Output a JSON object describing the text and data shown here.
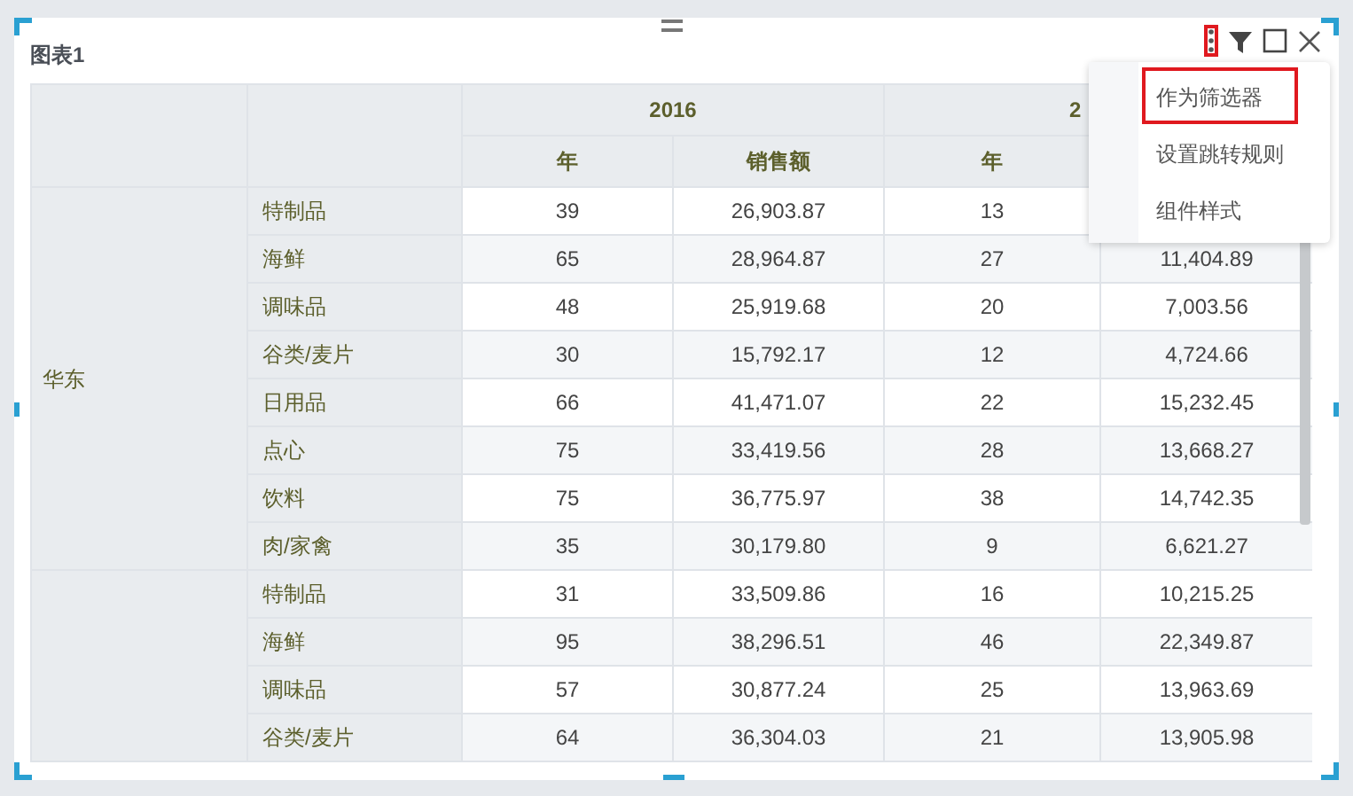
{
  "chart_title": "图表1",
  "toolbar": {
    "menu_open": true
  },
  "menu": {
    "items": [
      {
        "label": "作为筛选器",
        "highlighted": true
      },
      {
        "label": "设置跳转规则",
        "highlighted": false
      },
      {
        "label": "组件样式",
        "highlighted": false
      }
    ]
  },
  "table": {
    "years": [
      "2016",
      "2"
    ],
    "subheaders": [
      "年",
      "销售额",
      "年"
    ],
    "groups": [
      {
        "region": "华东",
        "rows": [
          {
            "category": "特制品",
            "values": [
              "39",
              "26,903.87",
              "13"
            ]
          },
          {
            "category": "海鲜",
            "values": [
              "65",
              "28,964.87",
              "27",
              "11,404.89"
            ]
          },
          {
            "category": "调味品",
            "values": [
              "48",
              "25,919.68",
              "20",
              "7,003.56"
            ]
          },
          {
            "category": "谷类/麦片",
            "values": [
              "30",
              "15,792.17",
              "12",
              "4,724.66"
            ]
          },
          {
            "category": "日用品",
            "values": [
              "66",
              "41,471.07",
              "22",
              "15,232.45"
            ]
          },
          {
            "category": "点心",
            "values": [
              "75",
              "33,419.56",
              "28",
              "13,668.27"
            ]
          },
          {
            "category": "饮料",
            "values": [
              "75",
              "36,775.97",
              "38",
              "14,742.35"
            ]
          },
          {
            "category": "肉/家禽",
            "values": [
              "35",
              "30,179.80",
              "9",
              "6,621.27"
            ]
          }
        ]
      },
      {
        "rows": [
          {
            "category": "特制品",
            "values": [
              "31",
              "33,509.86",
              "16",
              "10,215.25"
            ]
          },
          {
            "category": "海鲜",
            "values": [
              "95",
              "38,296.51",
              "46",
              "22,349.87"
            ]
          },
          {
            "category": "调味品",
            "values": [
              "57",
              "30,877.24",
              "25",
              "13,963.69"
            ]
          },
          {
            "category": "谷类/麦片",
            "values": [
              "64",
              "36,304.03",
              "21",
              "13,905.98"
            ]
          }
        ]
      }
    ]
  }
}
